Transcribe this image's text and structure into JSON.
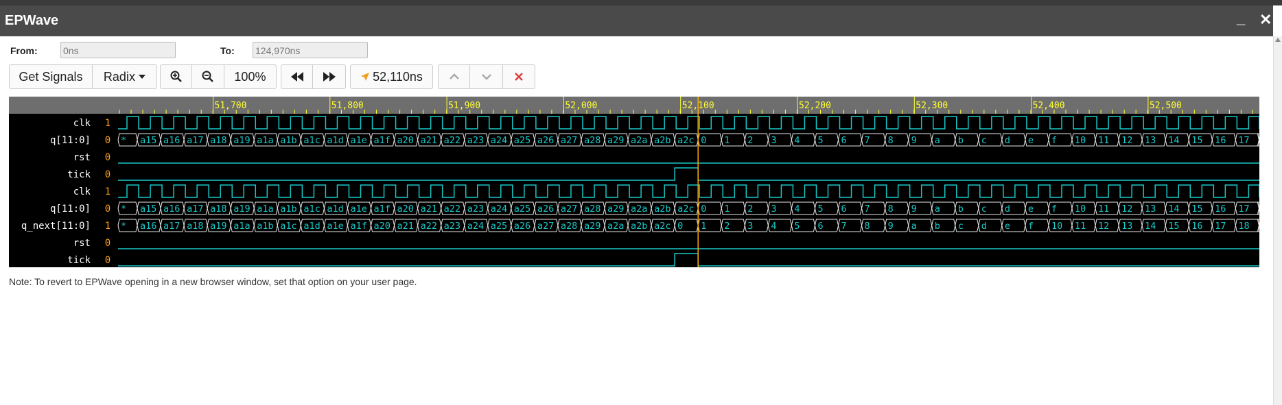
{
  "window": {
    "title": "EPWave",
    "minimize_glyph": "_",
    "close_glyph": "✕"
  },
  "range": {
    "from_label": "From:",
    "from_value": "0ns",
    "to_label": "To:",
    "to_value": "124,970ns"
  },
  "toolbar": {
    "get_signals": "Get Signals",
    "radix": "Radix",
    "zoom": "100%",
    "cursor_time": "52,110ns",
    "icons": [
      "zoom-in-icon",
      "zoom-out-icon",
      "rewind-icon",
      "fast-forward-icon",
      "cursor-arrow-icon",
      "chevron-up-icon",
      "chevron-down-icon",
      "close-icon"
    ]
  },
  "timeline": {
    "labels": [
      "51,700",
      "51,800",
      "51,900",
      "52,000",
      "52,100",
      "52,200",
      "52,300",
      "52,400",
      "52,500"
    ],
    "cursor_label": "52,110"
  },
  "signals": [
    {
      "name": "clk",
      "value": "1",
      "type": "clock"
    },
    {
      "name": "q[11:0]",
      "value": "0",
      "type": "bus",
      "start": "*",
      "values": [
        "a15",
        "a16",
        "a17",
        "a18",
        "a19",
        "a1a",
        "a1b",
        "a1c",
        "a1d",
        "a1e",
        "a1f",
        "a20",
        "a21",
        "a22",
        "a23",
        "a24",
        "a25",
        "a26",
        "a27",
        "a28",
        "a29",
        "a2a",
        "a2b",
        "a2c",
        "0",
        "1",
        "2",
        "3",
        "4",
        "5",
        "6",
        "7",
        "8",
        "9",
        "a",
        "b",
        "c",
        "d",
        "e",
        "f",
        "10",
        "11",
        "12",
        "13",
        "14",
        "15",
        "16",
        "17"
      ],
      "end": "*"
    },
    {
      "name": "rst",
      "value": "0",
      "type": "low"
    },
    {
      "name": "tick",
      "value": "0",
      "type": "tick"
    },
    {
      "name": "clk",
      "value": "1",
      "type": "clock"
    },
    {
      "name": "q[11:0]",
      "value": "0",
      "type": "bus",
      "start": "*",
      "values": [
        "a15",
        "a16",
        "a17",
        "a18",
        "a19",
        "a1a",
        "a1b",
        "a1c",
        "a1d",
        "a1e",
        "a1f",
        "a20",
        "a21",
        "a22",
        "a23",
        "a24",
        "a25",
        "a26",
        "a27",
        "a28",
        "a29",
        "a2a",
        "a2b",
        "a2c",
        "0",
        "1",
        "2",
        "3",
        "4",
        "5",
        "6",
        "7",
        "8",
        "9",
        "a",
        "b",
        "c",
        "d",
        "e",
        "f",
        "10",
        "11",
        "12",
        "13",
        "14",
        "15",
        "16",
        "17"
      ],
      "end": "*"
    },
    {
      "name": "q_next[11:0]",
      "value": "1",
      "type": "bus",
      "start": "*",
      "values": [
        "a16",
        "a17",
        "a18",
        "a19",
        "a1a",
        "a1b",
        "a1c",
        "a1d",
        "a1e",
        "a1f",
        "a20",
        "a21",
        "a22",
        "a23",
        "a24",
        "a25",
        "a26",
        "a27",
        "a28",
        "a29",
        "a2a",
        "a2b",
        "a2c",
        "0",
        "1",
        "2",
        "3",
        "4",
        "5",
        "6",
        "7",
        "8",
        "9",
        "a",
        "b",
        "c",
        "d",
        "e",
        "f",
        "10",
        "11",
        "12",
        "13",
        "14",
        "15",
        "16",
        "17",
        "18"
      ],
      "end": "*"
    },
    {
      "name": "rst",
      "value": "0",
      "type": "low"
    },
    {
      "name": "tick",
      "value": "0",
      "type": "tick"
    }
  ],
  "colors": {
    "wave": "#19c8c8",
    "clock_green": "#7ee03c",
    "value": "#ff9d1c",
    "ruler_text": "#ffff33",
    "cursor": "#ffaa00",
    "close_red": "#e03c3c"
  },
  "note": "Note: To revert to EPWave opening in a new browser window, set that option on your user page."
}
